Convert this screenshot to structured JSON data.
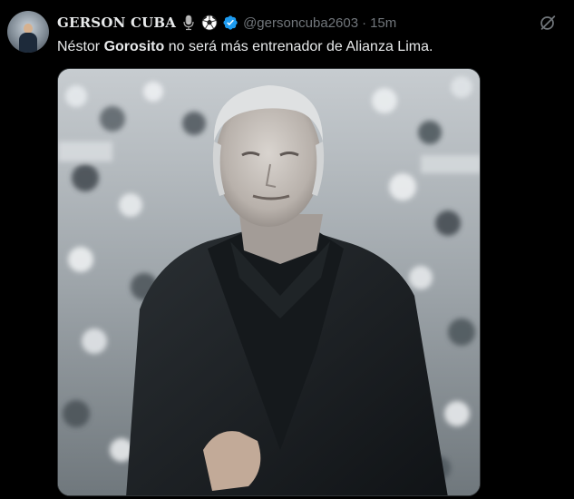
{
  "tweet": {
    "author": {
      "display_name": "GERSON CUBA",
      "badges": [
        "microphone-icon",
        "soccer-ball-icon",
        "verified-badge-icon"
      ],
      "handle": "@gersoncuba2603",
      "separator": "·",
      "time": "15m"
    },
    "text": {
      "part1": "Néstor ",
      "bold": "Gorosito",
      "part2": " no será más entrenador de Alianza Lima."
    },
    "actions": {
      "grok_icon": "grok-icon"
    },
    "media": {
      "type": "photo"
    },
    "colors": {
      "background": "#000000",
      "text_primary": "#e7e9ea",
      "text_secondary": "#71767b",
      "verified_blue": "#1d9bf0"
    }
  }
}
